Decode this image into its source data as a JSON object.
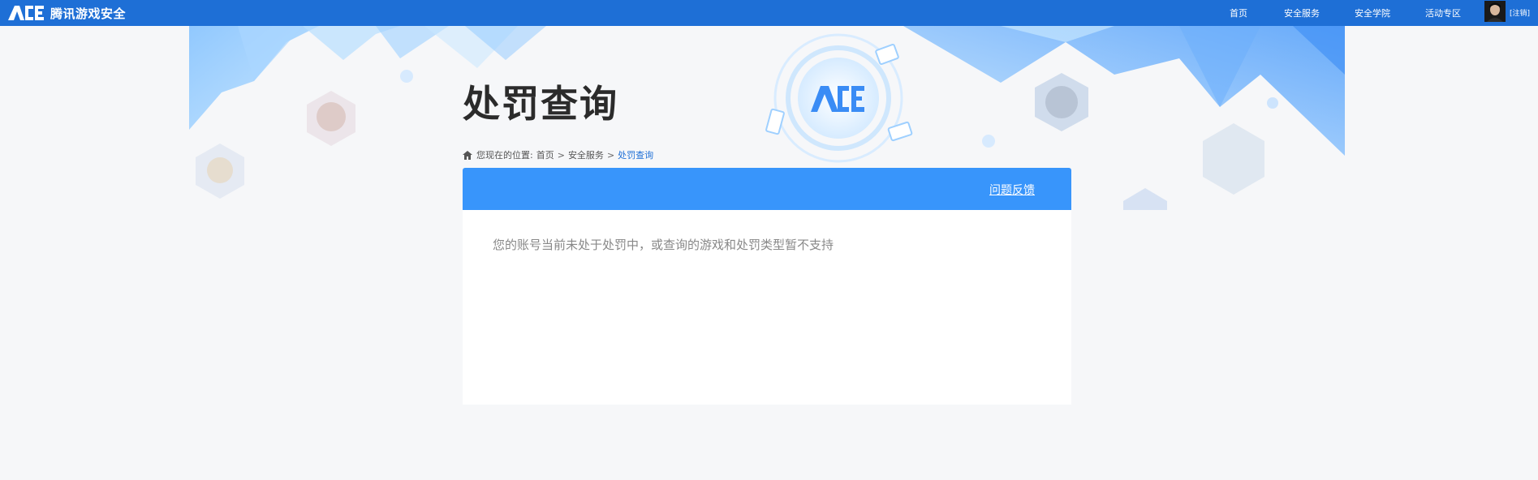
{
  "topbar": {
    "brand_name": "腾讯游戏安全",
    "nav": [
      "首页",
      "安全服务",
      "安全学院",
      "活动专区"
    ],
    "logout_label": "[注销]"
  },
  "page": {
    "title": "处罚查询"
  },
  "breadcrumb": {
    "prefix": "您现在的位置:",
    "items": [
      "首页",
      "安全服务"
    ],
    "current": "处罚查询",
    "separator": ">"
  },
  "panel": {
    "feedback_label": "问题反馈",
    "message": "您的账号当前未处于处罚中，或查询的游戏和处罚类型暂不支持"
  },
  "colors": {
    "topbar": "#1e6fd6",
    "panel_header": "#3895fb",
    "background": "#f6f7f9"
  }
}
